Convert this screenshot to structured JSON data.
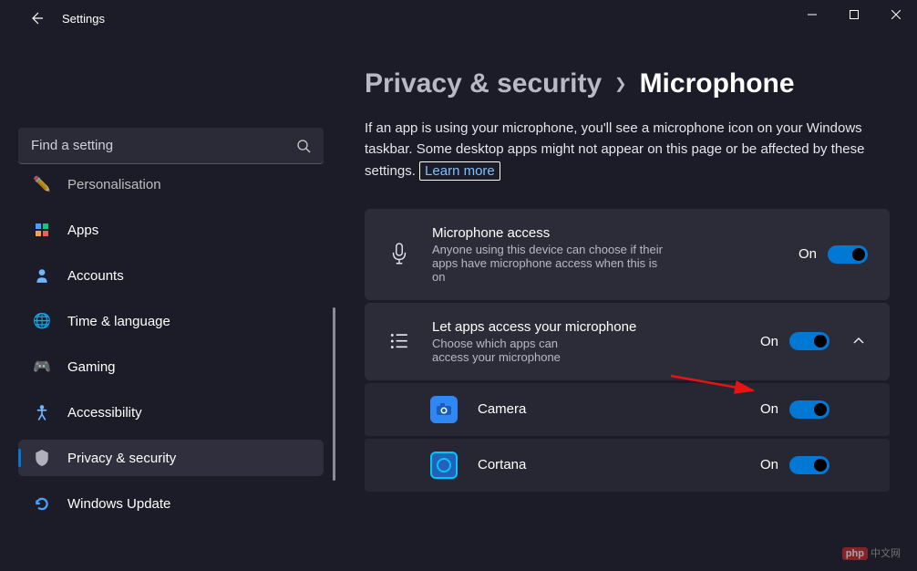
{
  "titlebar": {
    "title": "Settings"
  },
  "search": {
    "placeholder": "Find a setting"
  },
  "sidebar": {
    "items": [
      {
        "label": "Personalisation",
        "icon": "🖌️"
      },
      {
        "label": "Apps",
        "icon": "▦"
      },
      {
        "label": "Accounts",
        "icon": "👤"
      },
      {
        "label": "Time & language",
        "icon": "🌐"
      },
      {
        "label": "Gaming",
        "icon": "🎮"
      },
      {
        "label": "Accessibility",
        "icon": "♿"
      },
      {
        "label": "Privacy & security",
        "icon": "🛡️"
      },
      {
        "label": "Windows Update",
        "icon": "🔄"
      }
    ]
  },
  "breadcrumb": {
    "prev": "Privacy & security",
    "current": "Microphone"
  },
  "main": {
    "description": "If an app is using your microphone, you'll see a microphone icon on your Windows taskbar. Some desktop apps might not appear on this page or be affected by these settings.",
    "learn_more": "Learn more"
  },
  "cards": {
    "mic_access": {
      "title": "Microphone access",
      "sub": "Anyone using this device can choose if their apps have microphone access when this is on",
      "state": "On"
    },
    "let_apps": {
      "title": "Let apps access your microphone",
      "sub": "Choose which apps can access your microphone",
      "state": "On"
    }
  },
  "apps": [
    {
      "name": "Camera",
      "state": "On"
    },
    {
      "name": "Cortana",
      "state": "On"
    }
  ]
}
